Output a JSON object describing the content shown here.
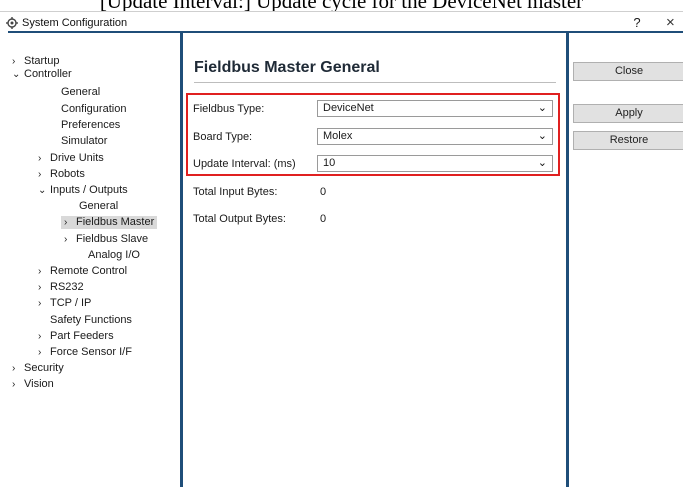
{
  "caption": "[Update Interval:] Update cycle for the DeviceNet master",
  "window": {
    "title": "System Configuration",
    "help_label": "?",
    "close_label": "×"
  },
  "tree": [
    {
      "label": "Startup",
      "chevron": "›"
    },
    {
      "label": "Controller",
      "chevron": "⌄"
    },
    {
      "label": "General",
      "chevron": ""
    },
    {
      "label": "Configuration",
      "chevron": ""
    },
    {
      "label": "Preferences",
      "chevron": ""
    },
    {
      "label": "Simulator",
      "chevron": ""
    },
    {
      "label": "Drive Units",
      "chevron": "›"
    },
    {
      "label": "Robots",
      "chevron": "›"
    },
    {
      "label": "Inputs / Outputs",
      "chevron": "⌄"
    },
    {
      "label": "General",
      "chevron": ""
    },
    {
      "label": "Fieldbus Master",
      "chevron": "›"
    },
    {
      "label": "Fieldbus Slave",
      "chevron": "›"
    },
    {
      "label": "Analog I/O",
      "chevron": ""
    },
    {
      "label": "Remote Control",
      "chevron": "›"
    },
    {
      "label": "RS232",
      "chevron": "›"
    },
    {
      "label": "TCP / IP",
      "chevron": "›"
    },
    {
      "label": "Safety Functions",
      "chevron": ""
    },
    {
      "label": "Part Feeders",
      "chevron": "›"
    },
    {
      "label": "Force Sensor I/F",
      "chevron": "›"
    },
    {
      "label": "Security",
      "chevron": "›"
    },
    {
      "label": "Vision",
      "chevron": "›"
    }
  ],
  "main": {
    "heading": "Fieldbus Master General",
    "fields": {
      "fieldbus_type": {
        "label": "Fieldbus Type:",
        "value": "DeviceNet"
      },
      "board_type": {
        "label": "Board Type:",
        "value": "Molex"
      },
      "update_interval": {
        "label": "Update Interval: (ms)",
        "value": "10"
      },
      "total_input": {
        "label": "Total Input Bytes:",
        "value": "0"
      },
      "total_output": {
        "label": "Total Output Bytes:",
        "value": "0"
      }
    }
  },
  "buttons": {
    "close": "Close",
    "apply": "Apply",
    "restore": "Restore"
  },
  "colors": {
    "frame": "#1f4e79",
    "highlight_box": "#e02020",
    "selected_bg": "#d9d9d9"
  }
}
